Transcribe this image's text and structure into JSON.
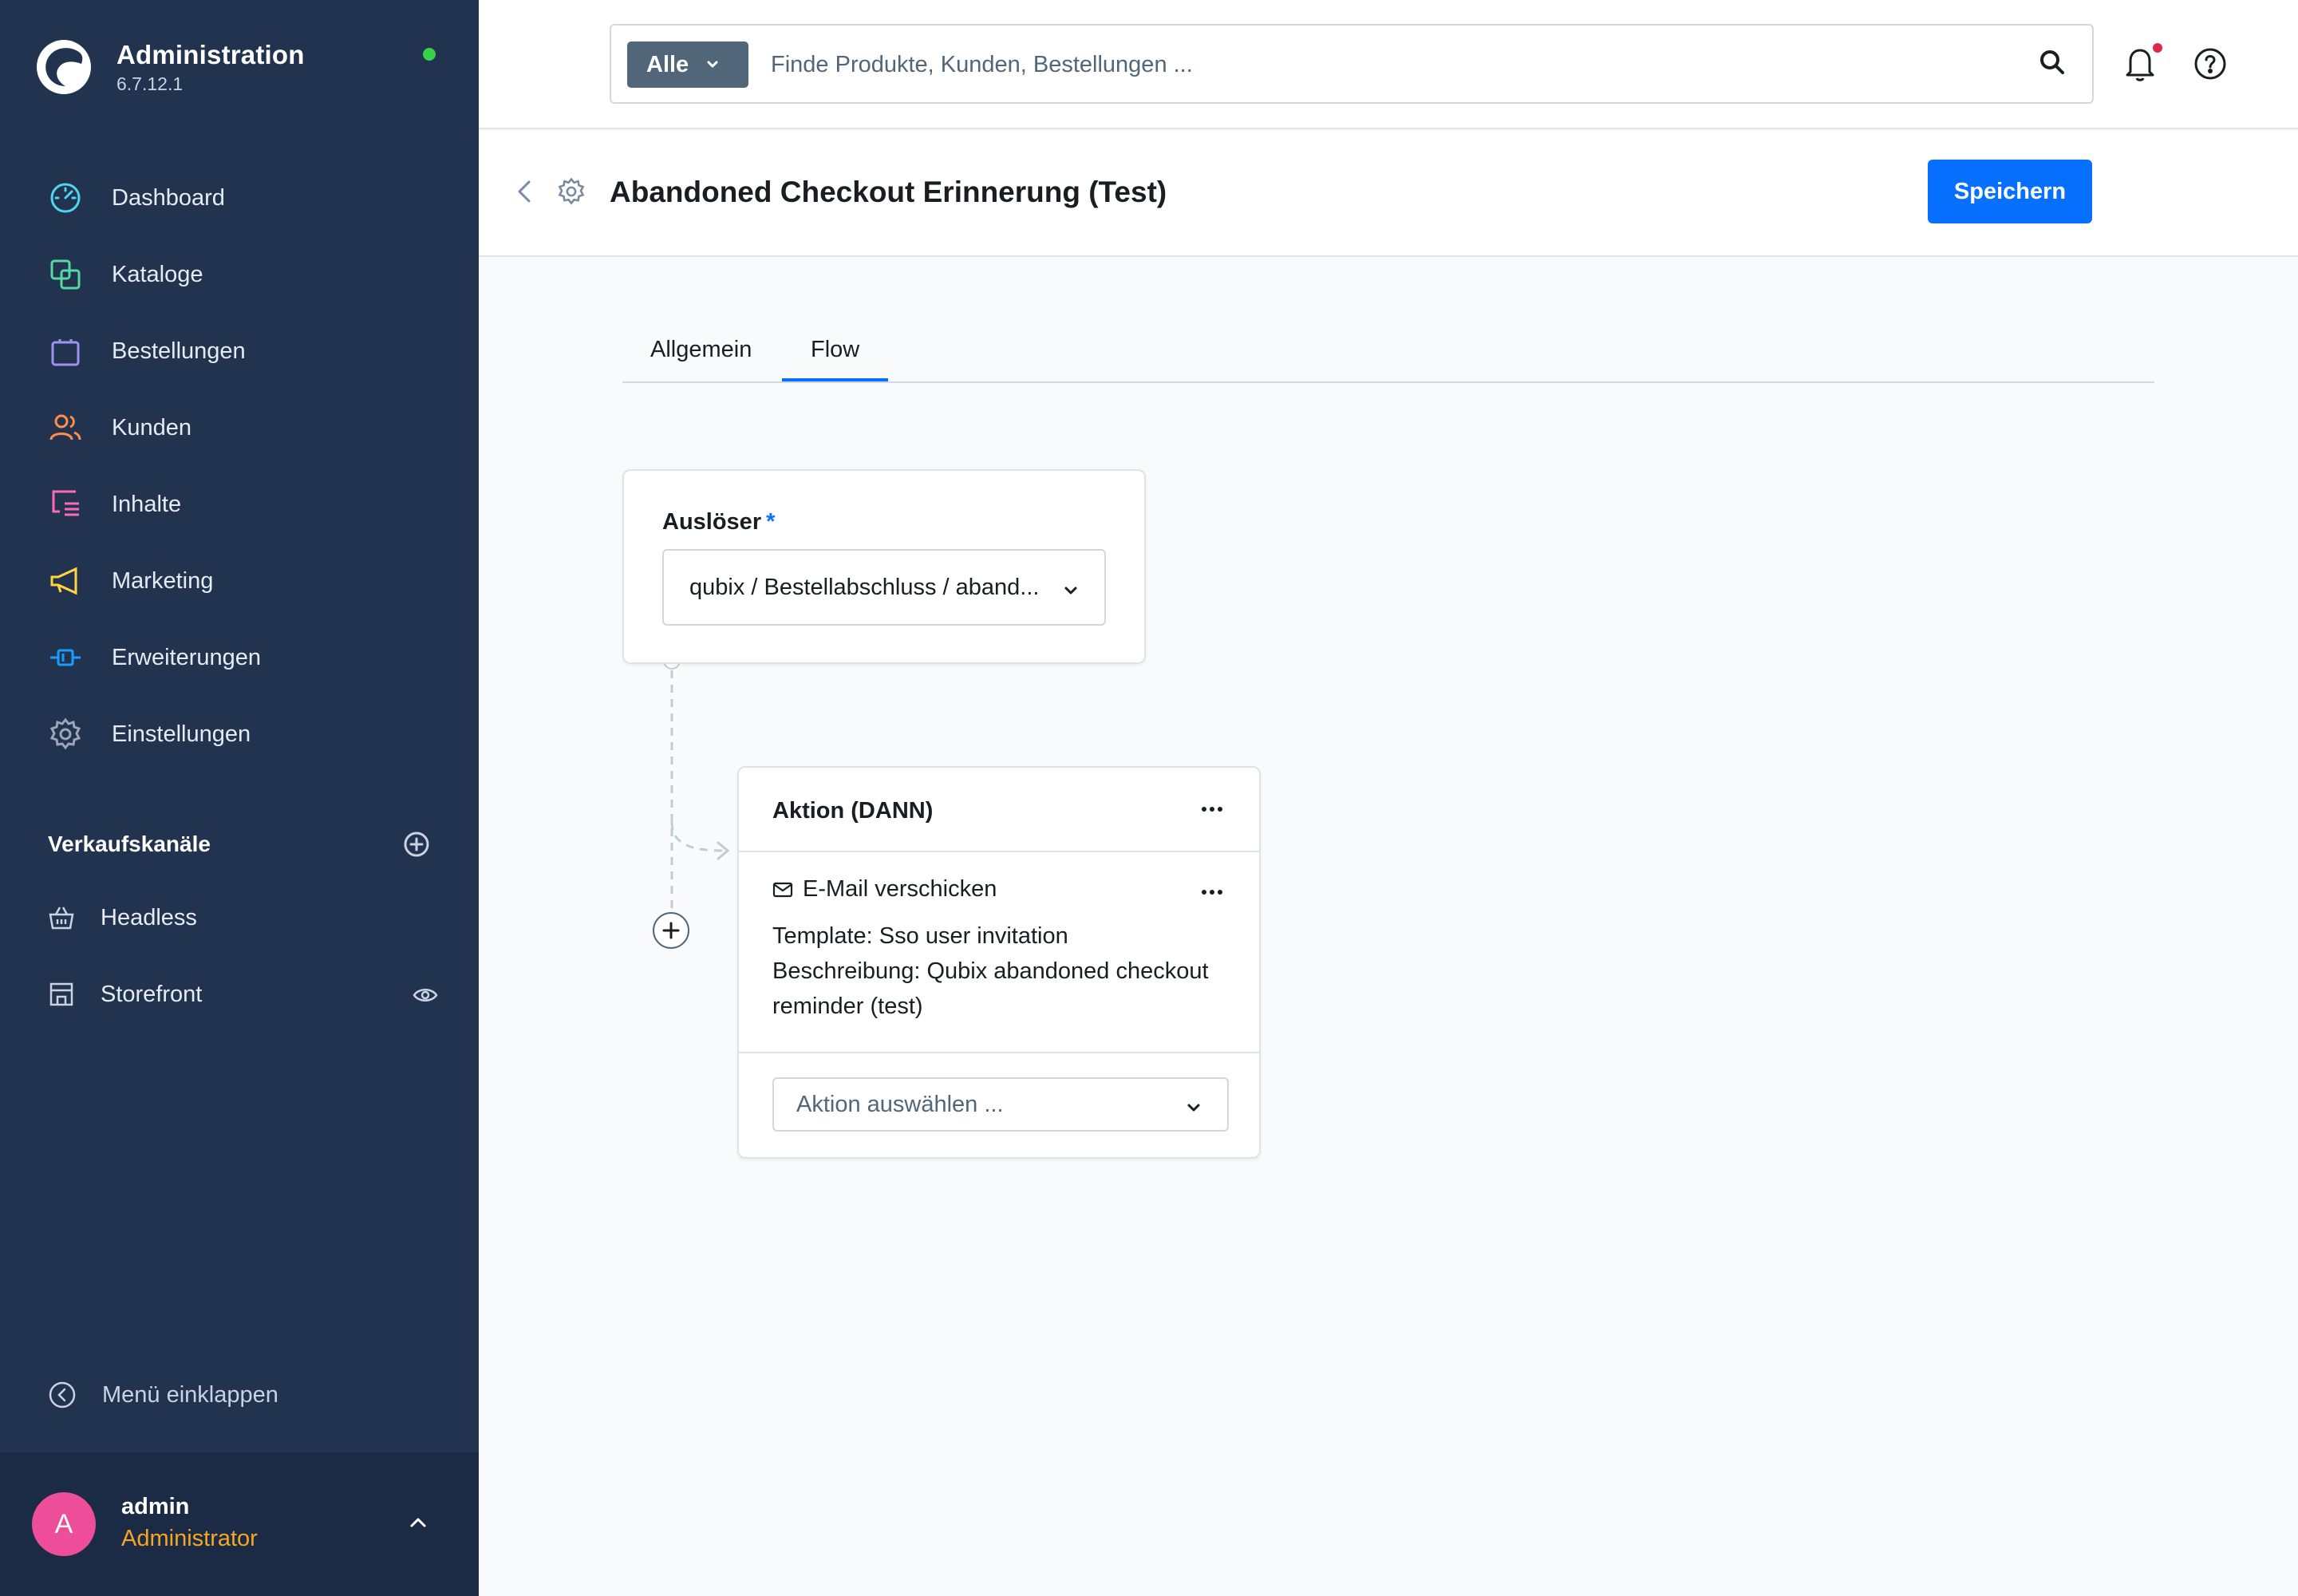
{
  "app": {
    "title": "Administration",
    "version": "6.7.12.1",
    "status_color": "#37d046"
  },
  "sidebar": {
    "items": [
      {
        "label": "Dashboard",
        "icon": "dashboard-icon",
        "color": "#4ed6f0"
      },
      {
        "label": "Kataloge",
        "icon": "catalog-icon",
        "color": "#57d9a3"
      },
      {
        "label": "Bestellungen",
        "icon": "shopping-bag-icon",
        "color": "#a092f0"
      },
      {
        "label": "Kunden",
        "icon": "customers-icon",
        "color": "#ff8c4a"
      },
      {
        "label": "Inhalte",
        "icon": "content-icon",
        "color": "#ff68b4"
      },
      {
        "label": "Marketing",
        "icon": "megaphone-icon",
        "color": "#ffd53d"
      },
      {
        "label": "Erweiterungen",
        "icon": "plug-icon",
        "color": "#189eff"
      },
      {
        "label": "Einstellungen",
        "icon": "settings-icon",
        "color": "#9aa8b5"
      }
    ],
    "sales_channels_title": "Verkaufskanäle",
    "sales_channels": [
      {
        "label": "Headless",
        "icon": "basket-icon"
      },
      {
        "label": "Storefront",
        "icon": "storefront-icon"
      }
    ],
    "collapse_label": "Menü einklappen",
    "user": {
      "initial": "A",
      "name": "admin",
      "role": "Administrator"
    }
  },
  "search": {
    "type_label": "Alle",
    "placeholder": "Finde Produkte, Kunden, Bestellungen ..."
  },
  "page": {
    "title": "Abandoned Checkout Erinnerung (Test)",
    "save_label": "Speichern"
  },
  "tabs": [
    {
      "label": "Allgemein",
      "active": false
    },
    {
      "label": "Flow",
      "active": true
    }
  ],
  "trigger": {
    "label": "Auslöser",
    "required_mark": "*",
    "value": "qubix / Bestellabschluss / aband..."
  },
  "action": {
    "title": "Aktion (DANN)",
    "item": {
      "title": "E-Mail verschicken",
      "icon": "mail-icon",
      "lines": [
        "Template: Sso user invitation",
        "Beschreibung: Qubix abandoned checkout",
        "reminder (test)"
      ]
    },
    "select_placeholder": "Aktion auswählen ..."
  },
  "colors": {
    "sidebar_bg": "#22334f",
    "accent": "#0870ff",
    "user_role": "#f5a623",
    "avatar": "#ee4d9a",
    "notification_dot": "#de294c"
  }
}
